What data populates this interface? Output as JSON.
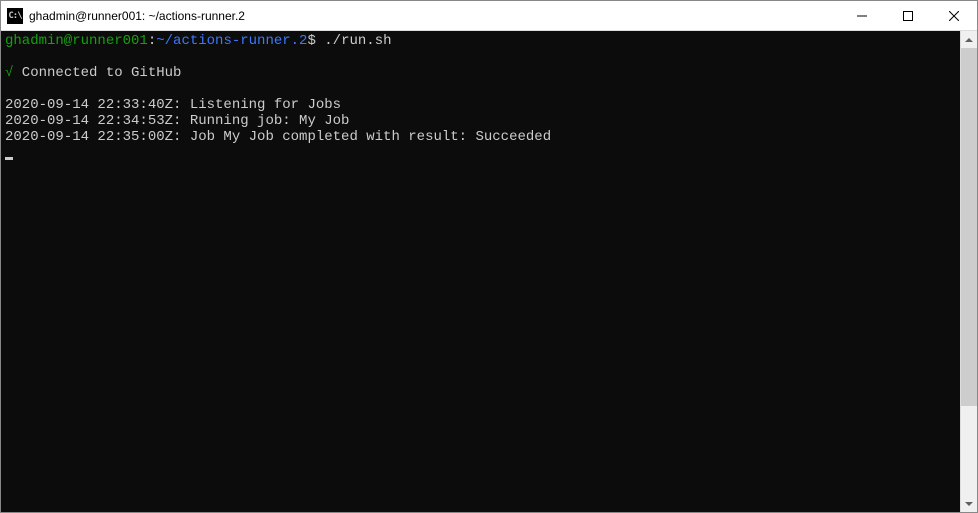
{
  "window": {
    "title": "ghadmin@runner001: ~/actions-runner.2",
    "icon_label": "C:\\"
  },
  "terminal": {
    "prompt": {
      "user_host": "ghadmin@runner001",
      "colon": ":",
      "path": "~/actions-runner.2",
      "dollar": "$",
      "command": "./run.sh"
    },
    "connected": {
      "check": "√",
      "text": " Connected to GitHub"
    },
    "lines": [
      "2020-09-14 22:33:40Z: Listening for Jobs",
      "2020-09-14 22:34:53Z: Running job: My Job",
      "2020-09-14 22:35:00Z: Job My Job completed with result: Succeeded"
    ]
  }
}
